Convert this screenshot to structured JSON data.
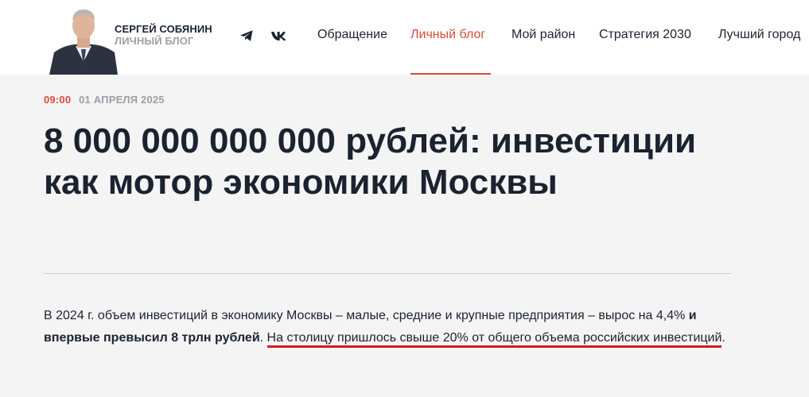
{
  "header": {
    "name": "СЕРГЕЙ СОБЯНИН",
    "subtitle": "ЛИЧНЫЙ БЛОГ",
    "social": [
      {
        "icon": "telegram-icon"
      },
      {
        "icon": "vk-icon"
      }
    ],
    "nav": [
      {
        "label": "Обращение",
        "active": false
      },
      {
        "label": "Личный блог",
        "active": true
      },
      {
        "label": "Мой район",
        "active": false
      },
      {
        "label": "Стратегия 2030",
        "active": false
      },
      {
        "label": "Лучший город",
        "active": false
      }
    ]
  },
  "article": {
    "time": "09:00",
    "date": "01 АПРЕЛЯ 2025",
    "title": "8 000 000 000 000 рублей: инвестиции как мотор экономики Москвы",
    "paragraph": {
      "part1": "В 2024 г. объем инвестиций в экономику Москвы – малые, средние и крупные предприятия – вырос на 4,4% ",
      "bold": "и впервые превысил 8 трлн рублей",
      "part2": ". ",
      "underlined": "На столицу пришлось свыше 20% от общего объема российских инвестиций",
      "end": "."
    }
  },
  "colors": {
    "accent": "#d94a3c",
    "underline": "#d61a1a",
    "text": "#1b2230",
    "muted": "#9aa0a6",
    "background": "#f4f4f4"
  }
}
